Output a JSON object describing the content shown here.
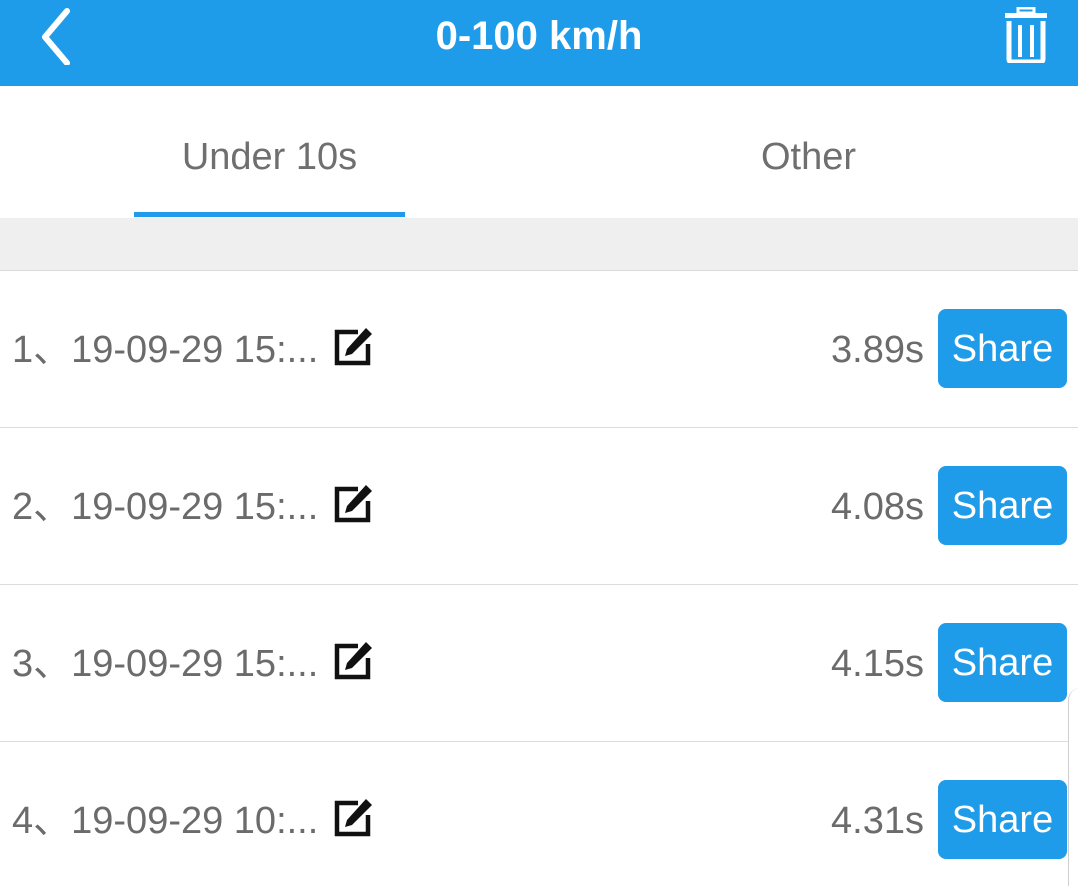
{
  "header": {
    "title": "0-100 km/h",
    "back_icon": "chevron-left-icon",
    "trash_icon": "trash-icon"
  },
  "tabs": [
    {
      "label": "Under 10s",
      "selected": true
    },
    {
      "label": "Other",
      "selected": false
    }
  ],
  "records": [
    {
      "label": "1、19-09-29 15:...",
      "time": "3.89s",
      "share_label": "Share"
    },
    {
      "label": "2、19-09-29 15:...",
      "time": "4.08s",
      "share_label": "Share"
    },
    {
      "label": "3、19-09-29 15:...",
      "time": "4.15s",
      "share_label": "Share"
    },
    {
      "label": "4、19-09-29 10:...",
      "time": "4.31s",
      "share_label": "Share"
    }
  ],
  "colors": {
    "accent": "#1e9be9",
    "text": "#6b6b6b",
    "band": "#efefef"
  }
}
